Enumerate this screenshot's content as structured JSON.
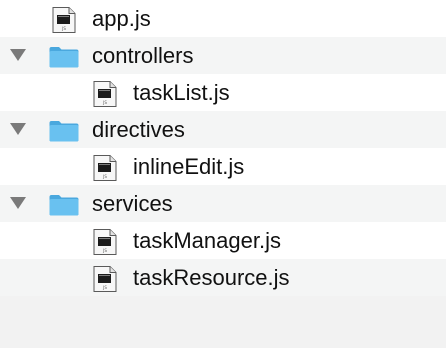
{
  "tree": {
    "rows": [
      {
        "label": "app.js",
        "type": "file",
        "depth": 0,
        "expanded": null,
        "icon": "js-file-icon"
      },
      {
        "label": "controllers",
        "type": "folder",
        "depth": 0,
        "expanded": true,
        "icon": "folder-icon"
      },
      {
        "label": "taskList.js",
        "type": "file",
        "depth": 1,
        "expanded": null,
        "icon": "js-file-icon"
      },
      {
        "label": "directives",
        "type": "folder",
        "depth": 0,
        "expanded": true,
        "icon": "folder-icon"
      },
      {
        "label": "inlineEdit.js",
        "type": "file",
        "depth": 1,
        "expanded": null,
        "icon": "js-file-icon"
      },
      {
        "label": "services",
        "type": "folder",
        "depth": 0,
        "expanded": true,
        "icon": "folder-icon"
      },
      {
        "label": "taskManager.js",
        "type": "file",
        "depth": 1,
        "expanded": null,
        "icon": "js-file-icon"
      },
      {
        "label": "taskResource.js",
        "type": "file",
        "depth": 1,
        "expanded": null,
        "icon": "js-file-icon"
      }
    ],
    "file_badge": "JS",
    "colors": {
      "folder": "#69c1f0",
      "folder_dark": "#4aa8de",
      "disclosure": "#7a7a7a",
      "row_alt": "#f4f5f5",
      "row": "#ffffff"
    }
  }
}
